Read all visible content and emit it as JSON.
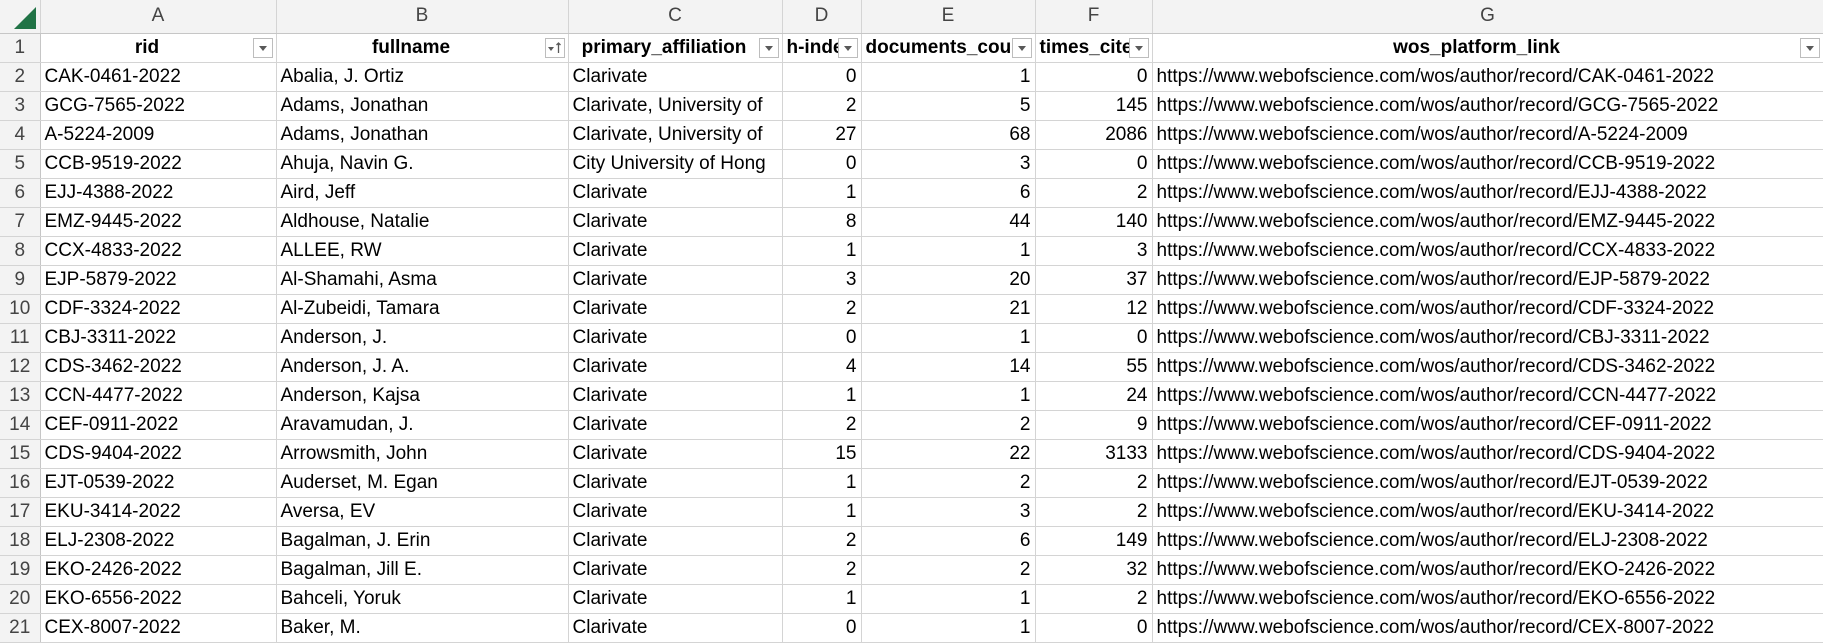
{
  "column_letters": [
    "A",
    "B",
    "C",
    "D",
    "E",
    "F",
    "G"
  ],
  "headers": [
    "rid",
    "fullname",
    "primary_affiliation",
    "h-index",
    "documents_count",
    "times_cited",
    "wos_platform_link"
  ],
  "filters": [
    {
      "icon": "dropdown-arrow-icon"
    },
    {
      "icon": "sort-ascending-filter-icon"
    },
    {
      "icon": "dropdown-arrow-icon"
    },
    {
      "icon": "dropdown-arrow-icon"
    },
    {
      "icon": "dropdown-arrow-icon"
    },
    {
      "icon": "dropdown-arrow-icon"
    },
    {
      "icon": "dropdown-arrow-icon"
    }
  ],
  "row_numbers": [
    "1",
    "2",
    "3",
    "4",
    "5",
    "6",
    "7",
    "8",
    "9",
    "10",
    "11",
    "12",
    "13",
    "14",
    "15",
    "16",
    "17",
    "18",
    "19",
    "20",
    "21"
  ],
  "rows": [
    [
      "CAK-0461-2022",
      "Abalia, J. Ortiz",
      "Clarivate",
      "0",
      "1",
      "0",
      "https://www.webofscience.com/wos/author/record/CAK-0461-2022"
    ],
    [
      "GCG-7565-2022",
      "Adams, Jonathan",
      "Clarivate, University of",
      "2",
      "5",
      "145",
      "https://www.webofscience.com/wos/author/record/GCG-7565-2022"
    ],
    [
      "A-5224-2009",
      "Adams, Jonathan",
      "Clarivate, University of",
      "27",
      "68",
      "2086",
      "https://www.webofscience.com/wos/author/record/A-5224-2009"
    ],
    [
      "CCB-9519-2022",
      "Ahuja, Navin G.",
      "City University of Hong",
      "0",
      "3",
      "0",
      "https://www.webofscience.com/wos/author/record/CCB-9519-2022"
    ],
    [
      "EJJ-4388-2022",
      "Aird, Jeff",
      "Clarivate",
      "1",
      "6",
      "2",
      "https://www.webofscience.com/wos/author/record/EJJ-4388-2022"
    ],
    [
      "EMZ-9445-2022",
      "Aldhouse, Natalie",
      "Clarivate",
      "8",
      "44",
      "140",
      "https://www.webofscience.com/wos/author/record/EMZ-9445-2022"
    ],
    [
      "CCX-4833-2022",
      "ALLEE, RW",
      "Clarivate",
      "1",
      "1",
      "3",
      "https://www.webofscience.com/wos/author/record/CCX-4833-2022"
    ],
    [
      "EJP-5879-2022",
      "Al-Shamahi, Asma",
      "Clarivate",
      "3",
      "20",
      "37",
      "https://www.webofscience.com/wos/author/record/EJP-5879-2022"
    ],
    [
      "CDF-3324-2022",
      "Al-Zubeidi, Tamara",
      "Clarivate",
      "2",
      "21",
      "12",
      "https://www.webofscience.com/wos/author/record/CDF-3324-2022"
    ],
    [
      "CBJ-3311-2022",
      "Anderson, J.",
      "Clarivate",
      "0",
      "1",
      "0",
      "https://www.webofscience.com/wos/author/record/CBJ-3311-2022"
    ],
    [
      "CDS-3462-2022",
      "Anderson, J. A.",
      "Clarivate",
      "4",
      "14",
      "55",
      "https://www.webofscience.com/wos/author/record/CDS-3462-2022"
    ],
    [
      "CCN-4477-2022",
      "Anderson, Kajsa",
      "Clarivate",
      "1",
      "1",
      "24",
      "https://www.webofscience.com/wos/author/record/CCN-4477-2022"
    ],
    [
      "CEF-0911-2022",
      "Aravamudan, J.",
      "Clarivate",
      "2",
      "2",
      "9",
      "https://www.webofscience.com/wos/author/record/CEF-0911-2022"
    ],
    [
      "CDS-9404-2022",
      "Arrowsmith, John",
      "Clarivate",
      "15",
      "22",
      "3133",
      "https://www.webofscience.com/wos/author/record/CDS-9404-2022"
    ],
    [
      "EJT-0539-2022",
      "Auderset, M. Egan",
      "Clarivate",
      "1",
      "2",
      "2",
      "https://www.webofscience.com/wos/author/record/EJT-0539-2022"
    ],
    [
      "EKU-3414-2022",
      "Aversa, EV",
      "Clarivate",
      "1",
      "3",
      "2",
      "https://www.webofscience.com/wos/author/record/EKU-3414-2022"
    ],
    [
      "ELJ-2308-2022",
      "Bagalman, J. Erin",
      "Clarivate",
      "2",
      "6",
      "149",
      "https://www.webofscience.com/wos/author/record/ELJ-2308-2022"
    ],
    [
      "EKO-2426-2022",
      "Bagalman, Jill E.",
      "Clarivate",
      "2",
      "2",
      "32",
      "https://www.webofscience.com/wos/author/record/EKO-2426-2022"
    ],
    [
      "EKO-6556-2022",
      "Bahceli, Yoruk",
      "Clarivate",
      "1",
      "1",
      "2",
      "https://www.webofscience.com/wos/author/record/EKO-6556-2022"
    ],
    [
      "CEX-8007-2022",
      "Baker, M.",
      "Clarivate",
      "0",
      "1",
      "0",
      "https://www.webofscience.com/wos/author/record/CEX-8007-2022"
    ]
  ],
  "numeric_columns": [
    3,
    4,
    5
  ],
  "colors": {
    "header_bg": "#f3f3f3",
    "gridline": "#d4d4d4",
    "select_all_triangle": "#217346"
  }
}
